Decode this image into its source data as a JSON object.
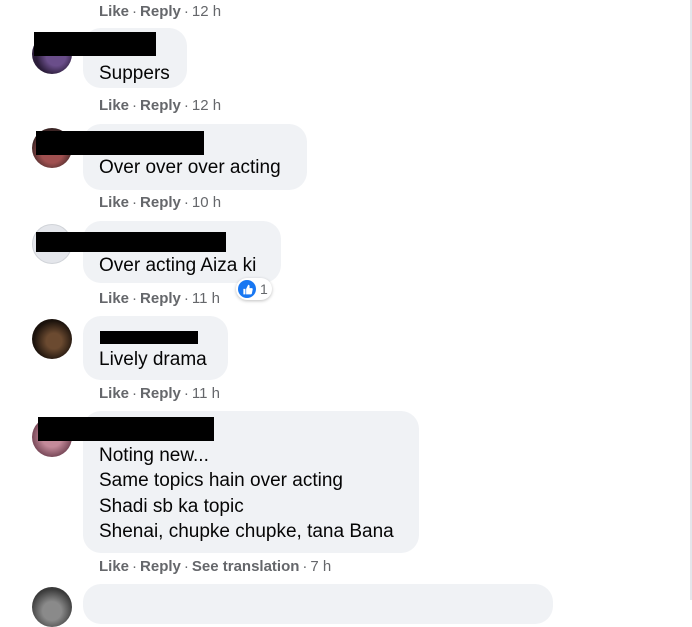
{
  "actions": {
    "like_label": "Like",
    "reply_label": "Reply",
    "see_translation_label": "See translation",
    "separator": "·"
  },
  "comments": [
    {
      "text_lines": [],
      "time": "12 h"
    },
    {
      "text_lines": [
        "Suppers"
      ],
      "time": "12 h"
    },
    {
      "text_lines": [
        "Over over over acting"
      ],
      "time": "10 h"
    },
    {
      "text_lines": [
        "Over acting Aiza ki"
      ],
      "time": "11 h",
      "reaction": {
        "icon": "like-icon",
        "count": "1"
      }
    },
    {
      "text_lines": [
        "Lively drama"
      ],
      "time": "11 h"
    },
    {
      "text_lines": [
        "Noting new...",
        "Same topics hain over acting",
        "Shadi sb ka topic",
        "Shenai, chupke chupke, tana Bana"
      ],
      "time": "7 h"
    }
  ],
  "colors": {
    "bubble_bg": "#f0f2f5",
    "action_text": "#65676b",
    "like_blue": "#1877f2"
  }
}
